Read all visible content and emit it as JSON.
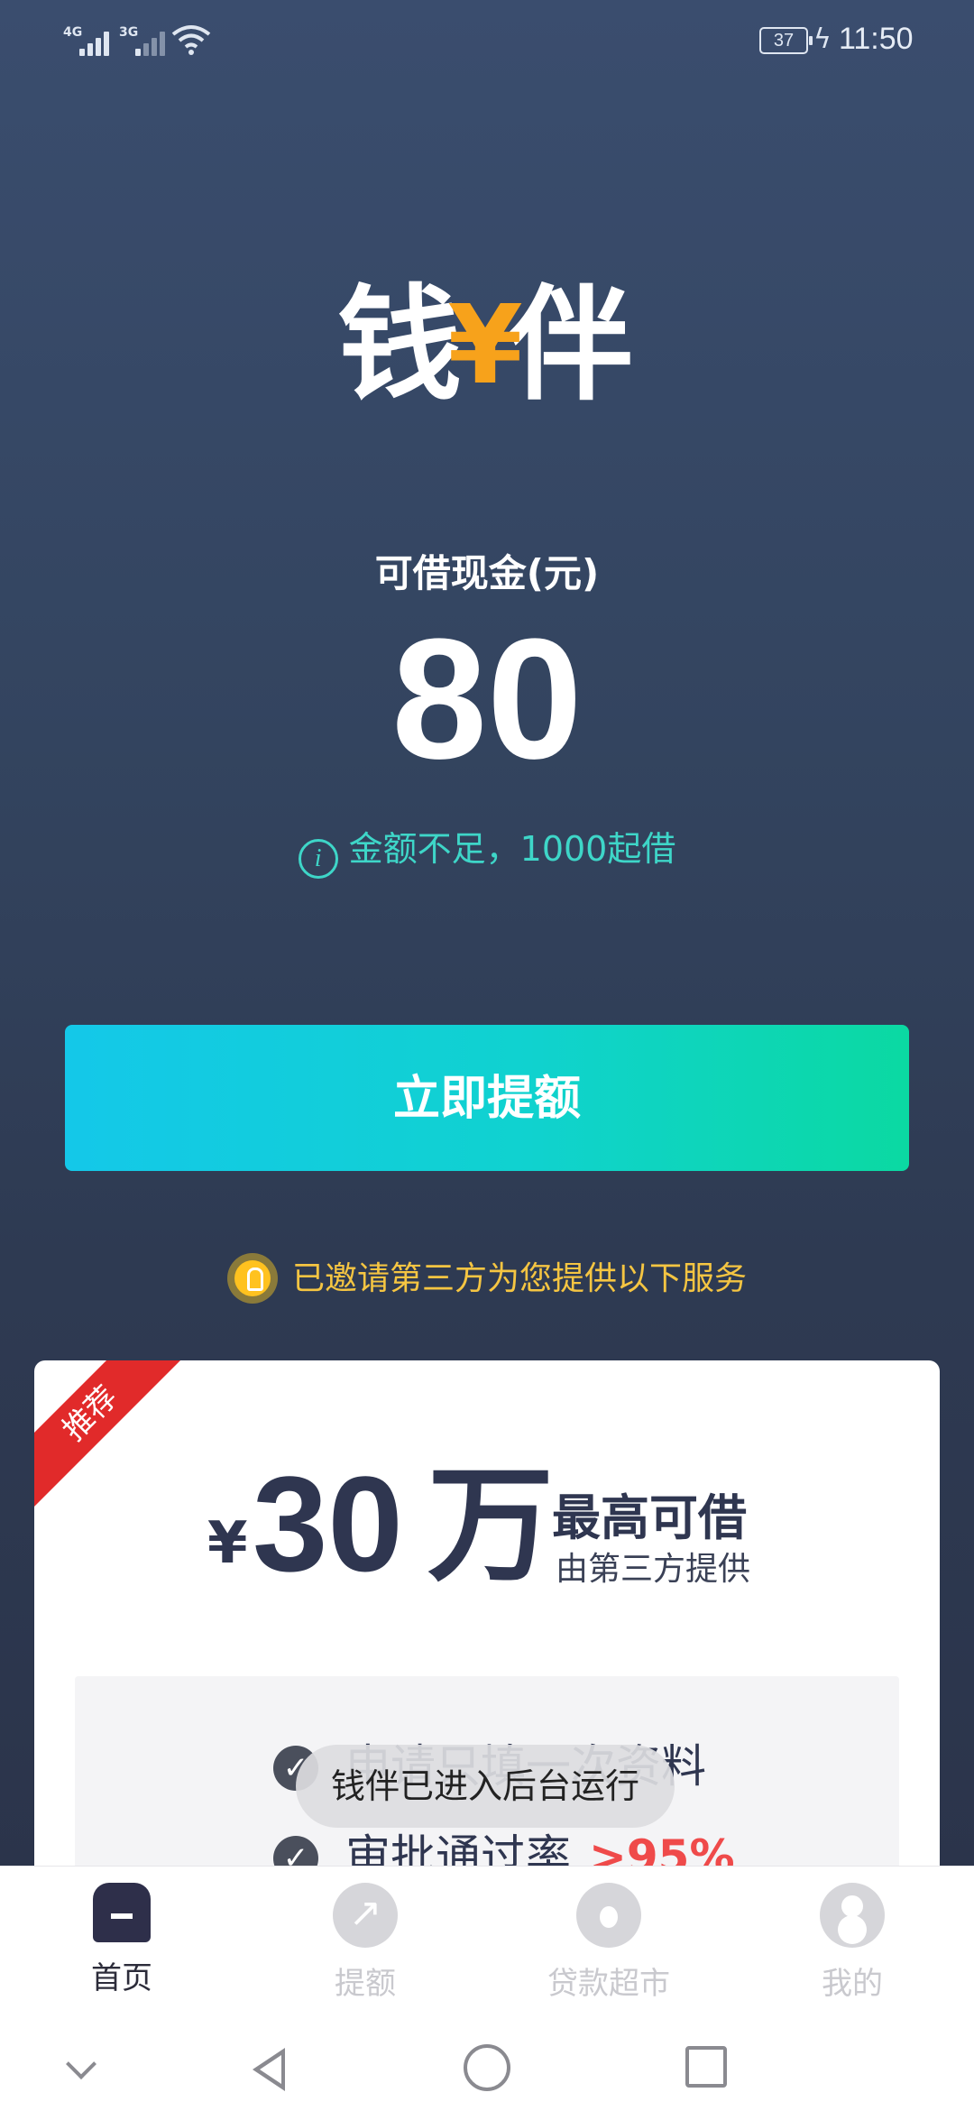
{
  "status_bar": {
    "network_1": "4G",
    "network_2": "3G",
    "battery": "37",
    "time": "11:50"
  },
  "header": {
    "logo_part1": "钱",
    "logo_accent": "¥",
    "logo_part2": "伴",
    "logo_accent_color": "#f7a21b"
  },
  "cash": {
    "label": "可借现金(元)",
    "amount": "80",
    "notice": "金额不足，1000起借",
    "notice_color": "#3ed6c8"
  },
  "actions": {
    "raise_button": "立即提额"
  },
  "invite": {
    "text": "已邀请第三方为您提供以下服务",
    "color": "#f5c542"
  },
  "promo_card": {
    "badge": "推荐",
    "currency": "¥",
    "amount": "30",
    "unit": "万",
    "headline": "最高可借",
    "provider": "由第三方提供",
    "features": [
      {
        "text": "申请只填一次资料"
      },
      {
        "text": "审批通过率",
        "highlight": ">95%"
      }
    ]
  },
  "toast": {
    "text": "钱伴已进入后台运行"
  },
  "tabbar": {
    "items": [
      {
        "label": "首页",
        "icon": "home-icon",
        "active": true
      },
      {
        "label": "提额",
        "icon": "trend-up-icon",
        "active": false
      },
      {
        "label": "贷款超市",
        "icon": "money-bag-icon",
        "active": false
      },
      {
        "label": "我的",
        "icon": "user-icon",
        "active": false
      }
    ]
  }
}
